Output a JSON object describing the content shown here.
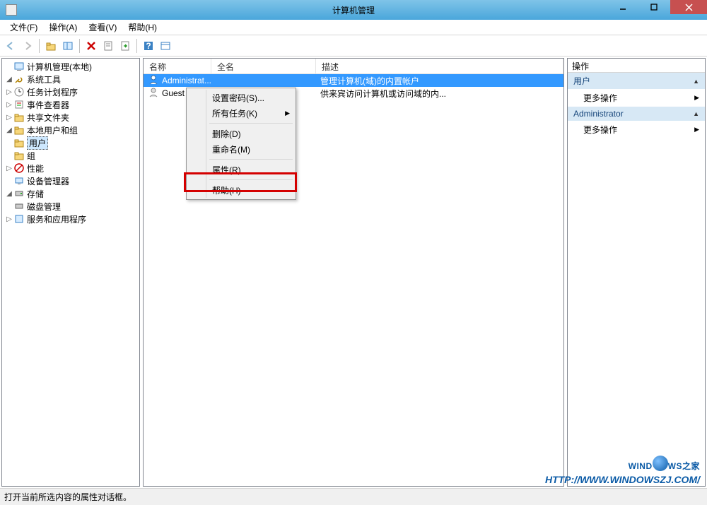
{
  "titlebar": {
    "title": "计算机管理"
  },
  "menubar": {
    "file": "文件(F)",
    "action": "操作(A)",
    "view": "查看(V)",
    "help": "帮助(H)"
  },
  "tree": {
    "root": "计算机管理(本地)",
    "system_tools": "系统工具",
    "task_scheduler": "任务计划程序",
    "event_viewer": "事件查看器",
    "shared_folders": "共享文件夹",
    "local_users_groups": "本地用户和组",
    "users": "用户",
    "groups": "组",
    "performance": "性能",
    "device_manager": "设备管理器",
    "storage": "存储",
    "disk_management": "磁盘管理",
    "services_apps": "服务和应用程序"
  },
  "list": {
    "columns": {
      "name": "名称",
      "fullname": "全名",
      "description": "描述"
    },
    "rows": [
      {
        "name": "Administrat...",
        "fullname": "",
        "description": "管理计算机(域)的内置帐户"
      },
      {
        "name": "Guest",
        "fullname": "",
        "description": "供来宾访问计算机或访问域的内..."
      }
    ]
  },
  "contextmenu": {
    "set_password": "设置密码(S)...",
    "all_tasks": "所有任务(K)",
    "delete": "删除(D)",
    "rename": "重命名(M)",
    "properties": "属性(R)",
    "help": "帮助(H)"
  },
  "actions": {
    "header": "操作",
    "group1_title": "用户",
    "group1_more": "更多操作",
    "group2_title": "Administrator",
    "group2_more": "更多操作"
  },
  "statusbar": {
    "text": "打开当前所选内容的属性对话框。"
  },
  "watermark": {
    "brand_pre": "WIND",
    "brand_post": "WS",
    "brand_suffix": "之家",
    "url": "HTTP://WWW.WINDOWSZJ.COM/"
  }
}
